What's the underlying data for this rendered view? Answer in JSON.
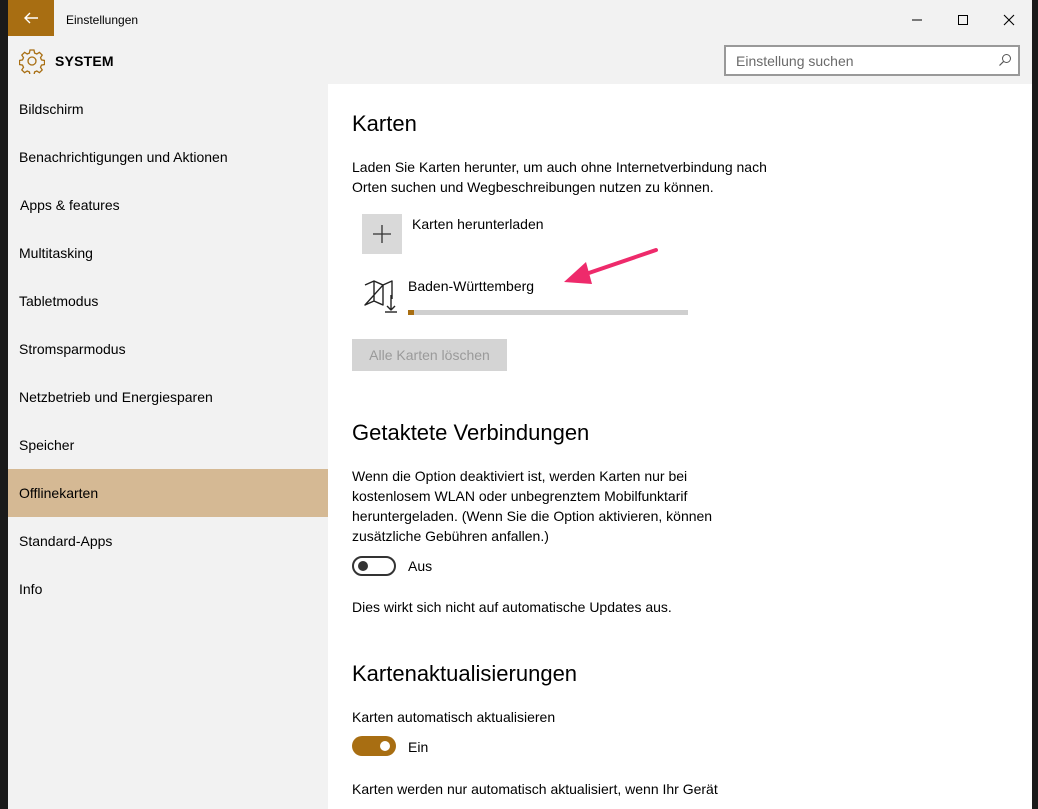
{
  "window": {
    "title": "Einstellungen"
  },
  "header": {
    "section_title": "SYSTEM",
    "search_placeholder": "Einstellung suchen"
  },
  "sidebar": {
    "items": [
      {
        "label": "Bildschirm",
        "active": false
      },
      {
        "label": "Benachrichtigungen und Aktionen",
        "active": false
      },
      {
        "label": "Apps & features",
        "active": false
      },
      {
        "label": "Multitasking",
        "active": false
      },
      {
        "label": "Tabletmodus",
        "active": false
      },
      {
        "label": "Stromsparmodus",
        "active": false
      },
      {
        "label": "Netzbetrieb und Energiesparen",
        "active": false
      },
      {
        "label": "Speicher",
        "active": false
      },
      {
        "label": "Offlinekarten",
        "active": true
      },
      {
        "label": "Standard-Apps",
        "active": false
      },
      {
        "label": "Info",
        "active": false
      }
    ]
  },
  "karten": {
    "title": "Karten",
    "description": "Laden Sie Karten herunter, um auch ohne Internetverbindung nach Orten suchen und Wegbeschreibungen nutzen zu können.",
    "add_label": "Karten herunterladen",
    "map_name": "Baden-Württemberg",
    "download_progress": 0.02,
    "delete_all_label": "Alle Karten löschen"
  },
  "metered": {
    "title": "Getaktete Verbindungen",
    "description": "Wenn die Option deaktiviert ist, werden Karten nur bei kostenlosem WLAN oder unbegrenztem Mobilfunktarif heruntergeladen. (Wenn Sie die Option aktivieren, können zusätzliche Gebühren anfallen.)",
    "toggle_label": "Aus",
    "toggle_on": false,
    "note": "Dies wirkt sich nicht auf automatische Updates aus."
  },
  "updates": {
    "title": "Kartenaktualisierungen",
    "auto_update_label": "Karten automatisch aktualisieren",
    "toggle_label": "Ein",
    "toggle_on": true,
    "description": "Karten werden nur automatisch aktualisiert, wenn Ihr Gerät"
  },
  "colors": {
    "accent": "#a86e12",
    "active_nav": "#d5b994",
    "sidebar_bg": "#f2f2f2",
    "annotation_arrow": "#ee2a6b"
  }
}
